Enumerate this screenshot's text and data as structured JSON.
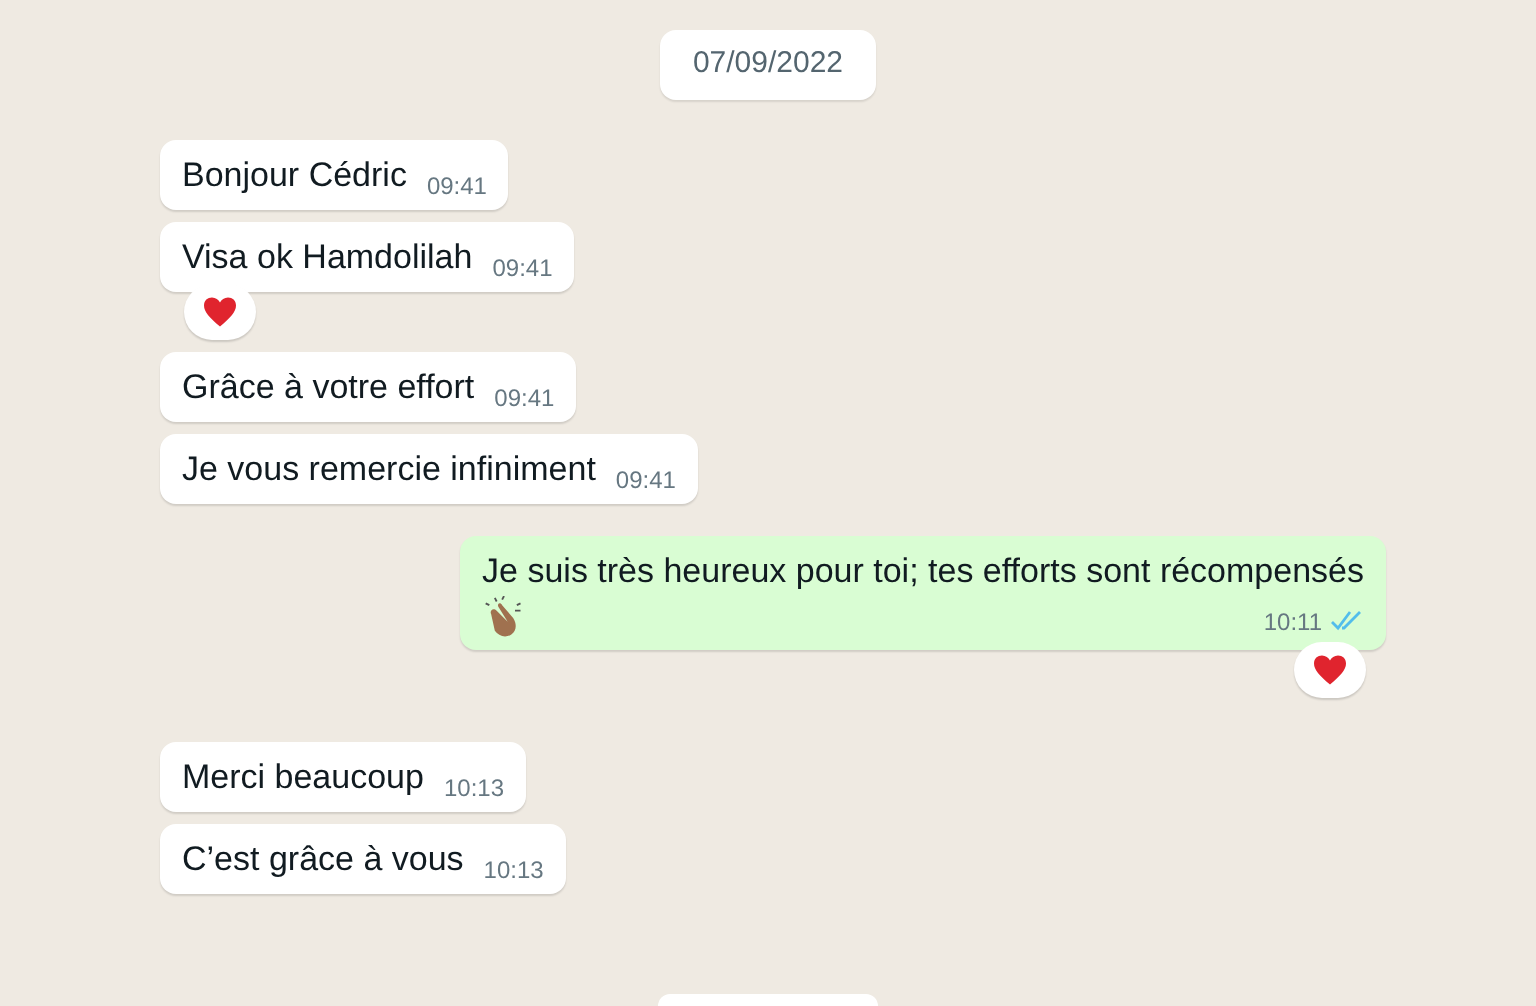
{
  "date_divider": "07/09/2022",
  "messages": [
    {
      "kind": "incoming",
      "text": "Bonjour Cédric",
      "time": "09:41"
    },
    {
      "kind": "incoming",
      "text": "Visa ok Hamdolilah",
      "time": "09:41",
      "reaction": {
        "kind": "heart"
      }
    },
    {
      "kind": "incoming",
      "text": "Grâce à votre effort",
      "time": "09:41"
    },
    {
      "kind": "incoming",
      "text": "Je vous remercie infiniment",
      "time": "09:41"
    },
    {
      "kind": "outgoing",
      "text": "Je suis très heureux pour toi; tes efforts sont récompensés",
      "emoji": {
        "kind": "clap"
      },
      "time": "10:11",
      "read": true,
      "reaction": {
        "kind": "heart"
      }
    },
    {
      "kind": "incoming",
      "text": "Merci beaucoup",
      "time": "10:13"
    },
    {
      "kind": "incoming",
      "text": "C’est grâce à vous",
      "time": "10:13"
    }
  ]
}
